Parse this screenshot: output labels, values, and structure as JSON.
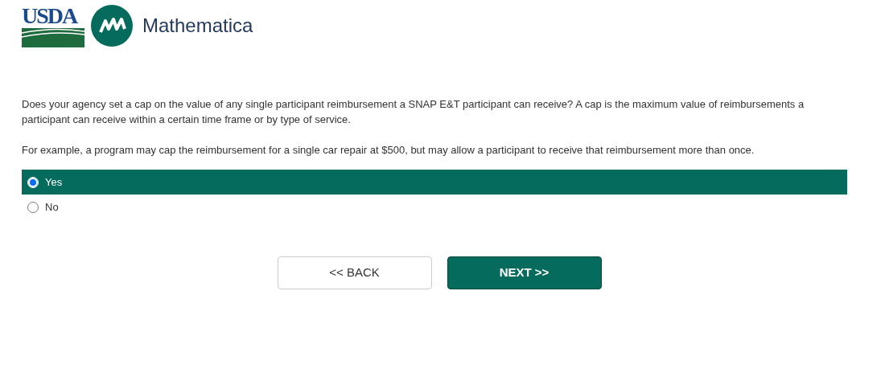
{
  "header": {
    "usda_logo": "USDA",
    "partner_logo": "Mathematica"
  },
  "question": {
    "paragraphs": [
      "Does your agency set a cap on the value of any single participant reimbursement a SNAP E&T participant can receive? A cap is the maximum value of reimbursements a participant can receive within a certain time frame or by type of service.",
      "For example, a program may cap the reimbursement for a single car repair at $500, but may allow a participant to receive that reimbursement more than once."
    ],
    "options": [
      {
        "label": "Yes",
        "selected": true
      },
      {
        "label": "No",
        "selected": false
      }
    ]
  },
  "buttons": [
    {
      "label": "<< BACK",
      "kind": "secondary"
    },
    {
      "label": "NEXT >>",
      "kind": "primary"
    }
  ]
}
